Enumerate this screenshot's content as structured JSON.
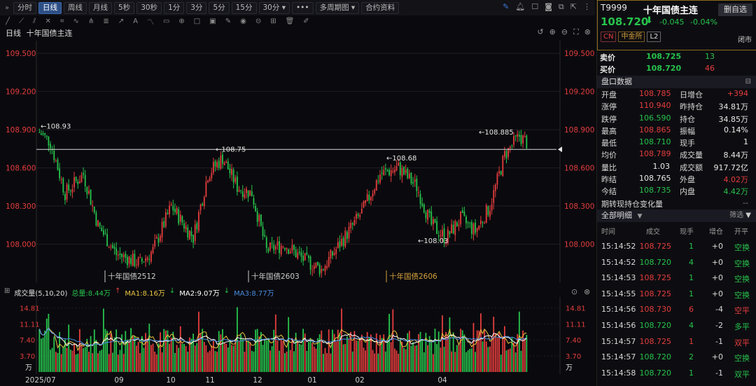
{
  "toolbar": {
    "periods": [
      "分时",
      "日线",
      "周线",
      "月线",
      "5秒",
      "30秒",
      "1分",
      "3分",
      "5分",
      "15分",
      "30分"
    ],
    "active_period": "日线",
    "more": "•••",
    "multi_period": "多周期图",
    "contract_info": "合约资料"
  },
  "chart": {
    "period_label": "日线",
    "title": "十年国债主连",
    "y_axis": {
      "min": 107.7,
      "max": 109.6,
      "ticks": [
        "109.500",
        "109.200",
        "108.900",
        "108.600",
        "108.300",
        "108.000"
      ]
    },
    "x_axis_labels": [
      "2025/07",
      "09",
      "10",
      "11",
      "12",
      "01",
      "02",
      "04"
    ],
    "annotations": [
      "108.93",
      "108.75",
      "108.68",
      "108.885",
      "108.03"
    ],
    "contract_labels": [
      "十年国债2512",
      "十年国债2603",
      "十年国债2606"
    ],
    "last_price_line": 108.745
  },
  "volume": {
    "title": "成交量(5,10,20)",
    "total": "总量:8.44万",
    "ma1": "MA1:8.16万",
    "ma2": "MA2:9.07万",
    "ma3": "MA3:8.77万",
    "y_ticks": [
      "14.81",
      "11.11",
      "7.40",
      "3.70"
    ],
    "unit": "万"
  },
  "quote": {
    "code": "T9999",
    "name": "十年国债主连",
    "watch_button": "删自选",
    "price": "108.720",
    "arrow": "⬇",
    "change": "-0.045",
    "change_pct": "-0.04%",
    "tags": [
      "CN",
      "中金所",
      "L2"
    ],
    "status": "闭市"
  },
  "book": {
    "sell_label": "卖价",
    "sell_price": "108.725",
    "sell_vol": "13",
    "buy_label": "买价",
    "buy_price": "108.720",
    "buy_vol": "46"
  },
  "stats_title": "盘口数据",
  "stats": [
    {
      "l": "开盘",
      "v": "108.785",
      "vc": "red",
      "l2": "日增仓",
      "v2": "+394",
      "v2c": "red"
    },
    {
      "l": "涨停",
      "v": "110.940",
      "vc": "red",
      "l2": "昨持仓",
      "v2": "34.81万",
      "v2c": "white"
    },
    {
      "l": "跌停",
      "v": "106.590",
      "vc": "green",
      "l2": "持仓",
      "v2": "34.85万",
      "v2c": "white"
    },
    {
      "l": "最高",
      "v": "108.865",
      "vc": "red",
      "l2": "振幅",
      "v2": "0.14%",
      "v2c": "white"
    },
    {
      "l": "最低",
      "v": "108.710",
      "vc": "green",
      "l2": "现手",
      "v2": "1",
      "v2c": "white"
    },
    {
      "l": "均价",
      "v": "108.789",
      "vc": "red",
      "l2": "成交量",
      "v2": "8.44万",
      "v2c": "white"
    },
    {
      "l": "量比",
      "v": "1.03",
      "vc": "white",
      "l2": "成交额",
      "v2": "917.72亿",
      "v2c": "white"
    },
    {
      "l": "昨结",
      "v": "108.765",
      "vc": "white",
      "l2": "外盘",
      "v2": "4.02万",
      "v2c": "red"
    },
    {
      "l": "今结",
      "v": "108.735",
      "vc": "green",
      "l2": "内盘",
      "v2": "4.42万",
      "v2c": "green"
    },
    {
      "l": "期转现持仓变化量",
      "v": "",
      "vc": "white",
      "l2": "",
      "v2": "--",
      "v2c": "dim"
    }
  ],
  "ticks_title": "全部明细",
  "ticks_filter": "筛选",
  "ticks_header": [
    "时间",
    "成交",
    "现手",
    "增仓",
    "开平"
  ],
  "ticks": [
    {
      "t": "15:14:52",
      "p": "108.725",
      "pc": "red",
      "v": "1",
      "vcl": "green",
      "d": "+0",
      "k": "空换",
      "kc": "green"
    },
    {
      "t": "15:14:52",
      "p": "108.720",
      "pc": "green",
      "v": "4",
      "vcl": "green",
      "d": "+0",
      "k": "空换",
      "kc": "green"
    },
    {
      "t": "15:14:53",
      "p": "108.725",
      "pc": "red",
      "v": "1",
      "vcl": "green",
      "d": "+0",
      "k": "空换",
      "kc": "green"
    },
    {
      "t": "15:14:55",
      "p": "108.725",
      "pc": "red",
      "v": "1",
      "vcl": "green",
      "d": "+0",
      "k": "空换",
      "kc": "green"
    },
    {
      "t": "15:14:56",
      "p": "108.730",
      "pc": "red",
      "v": "6",
      "vcl": "red",
      "d": "-4",
      "k": "空平",
      "kc": "red"
    },
    {
      "t": "15:14:56",
      "p": "108.720",
      "pc": "green",
      "v": "4",
      "vcl": "green",
      "d": "-2",
      "k": "多平",
      "kc": "green"
    },
    {
      "t": "15:14:57",
      "p": "108.725",
      "pc": "red",
      "v": "1",
      "vcl": "red",
      "d": "-1",
      "k": "双平",
      "kc": "red"
    },
    {
      "t": "15:14:57",
      "p": "108.720",
      "pc": "green",
      "v": "2",
      "vcl": "green",
      "d": "+0",
      "k": "空换",
      "kc": "green"
    },
    {
      "t": "15:14:58",
      "p": "108.720",
      "pc": "green",
      "v": "1",
      "vcl": "green",
      "d": "-1",
      "k": "双平",
      "kc": "green"
    }
  ],
  "colors": {
    "up": "#e43d3d",
    "down": "#27c24c",
    "accent": "#2d4f86",
    "ma1": "#e8c440",
    "ma2": "#ffffff",
    "ma3": "#4a8be0"
  }
}
